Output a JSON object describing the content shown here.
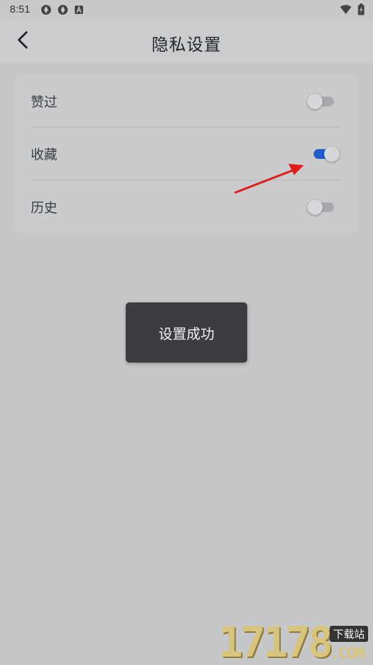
{
  "status_bar": {
    "time": "8:51",
    "notification_icons": [
      "aperture-icon",
      "aperture-icon",
      "a-badge-icon"
    ],
    "right_icons": [
      "wifi-icon",
      "battery-charging-icon"
    ]
  },
  "header": {
    "title": "隐私设置",
    "back_icon": "chevron-left-icon"
  },
  "settings": {
    "items": [
      {
        "label": "赞过",
        "enabled": false
      },
      {
        "label": "收藏",
        "enabled": true
      },
      {
        "label": "历史",
        "enabled": false
      }
    ]
  },
  "toast": {
    "message": "设置成功"
  },
  "watermark": {
    "digits": "17178",
    "badge": "下载站",
    "domain": ".COM"
  },
  "colors": {
    "toggle_on": "#1d5fcf",
    "toggle_off": "#a6a8ad",
    "annotation_arrow": "#e11b1b",
    "toast_bg": "#3c3d40"
  }
}
